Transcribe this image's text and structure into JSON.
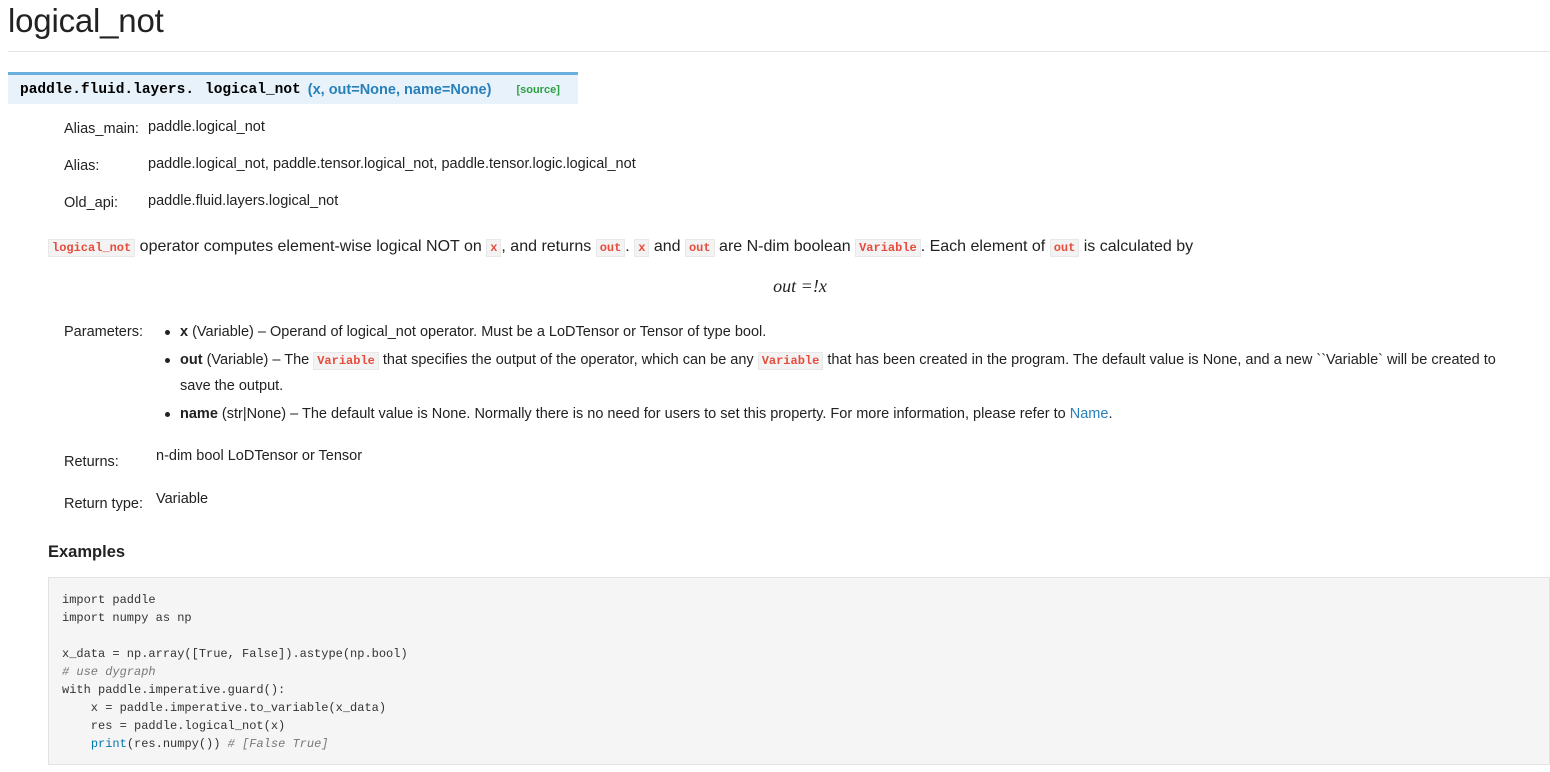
{
  "page": {
    "title": "logical_not"
  },
  "signature": {
    "prename": "paddle.fluid.layers.",
    "name": "logical_not",
    "params": "(x, out=None, name=None)",
    "source_link": "[source]"
  },
  "fields": {
    "alias_main_label": "Alias_main:",
    "alias_main_value": "paddle.logical_not",
    "alias_label": "Alias:",
    "alias_value": "paddle.logical_not, paddle.tensor.logical_not, paddle.tensor.logic.logical_not",
    "old_api_label": "Old_api:",
    "old_api_value": "paddle.fluid.layers.logical_not"
  },
  "description": {
    "c1": "logical_not",
    "t1": " operator computes element-wise logical NOT on ",
    "c2": "x",
    "t2": ", and returns ",
    "c3": "out",
    "t3": ". ",
    "c4": "x",
    "t4": " and ",
    "c5": "out",
    "t5": " are N-dim boolean ",
    "c6": "Variable",
    "t6": ". Each element of ",
    "c7": "out",
    "t7": " is calculated by"
  },
  "formula": "out =!x",
  "parameters": {
    "label": "Parameters:",
    "x_name": "x",
    "x_desc": " (Variable) – Operand of logical_not operator. Must be a LoDTensor or Tensor of type bool.",
    "out_name": "out",
    "out_desc1": " (Variable) – The ",
    "out_code1": "Variable",
    "out_desc2": " that specifies the output of the operator, which can be any ",
    "out_code2": "Variable",
    "out_desc3": " that has been created in the program. The default value is None, and a new ``Variable` will be created to save the output.",
    "name_name": "name",
    "name_desc": " (str|None) – The default value is None. Normally there is no need for users to set this property. For more information, please refer to ",
    "name_link": "Name",
    "name_end": "."
  },
  "returns": {
    "label": "Returns:",
    "value": "n-dim bool LoDTensor or Tensor",
    "type_label": "Return type:",
    "type_value": "Variable"
  },
  "examples": {
    "heading": "Examples",
    "lines": {
      "l1": "import paddle",
      "l2": "import numpy as np",
      "l4": "x_data = np.array([True, False]).astype(np.bool)",
      "l5": "# use dygraph",
      "l6": "with paddle.imperative.guard():",
      "l7": "    x = paddle.imperative.to_variable(x_data)",
      "l8": "    res = paddle.logical_not(x)",
      "l9_print": "print",
      "l9_rest": "(res.numpy()) ",
      "l9_comment": "# [False True]"
    }
  }
}
